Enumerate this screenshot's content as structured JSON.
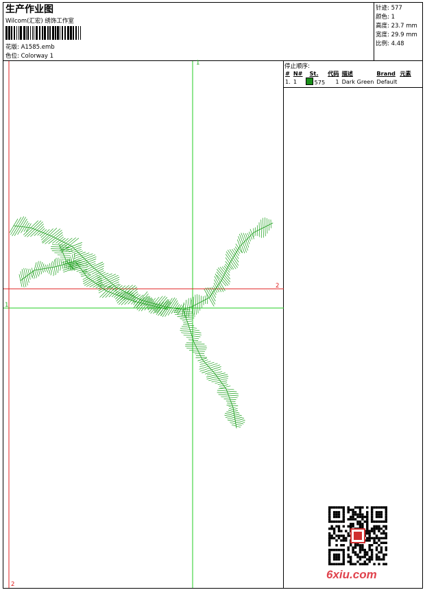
{
  "header": {
    "title": "生产作业图",
    "subtitle": "Wilcom(汇宏) 绣饰工作室",
    "design_label": "花版:",
    "design_value": "A1585.emb",
    "colorway_label": "色位:",
    "colorway_value": "Colorway 1"
  },
  "stats": {
    "stitches_label": "针迹:",
    "stitches": "577",
    "colors_label": "颜色:",
    "colors": "1",
    "height_label": "高度:",
    "height": "23.7 mm",
    "width_label": "宽度:",
    "width": "29.9 mm",
    "scale_label": "比例:",
    "scale": "4.48"
  },
  "stop_sequence": {
    "title": "停止顺序:",
    "columns": [
      "#",
      "N#",
      "St.",
      "代码",
      "描述",
      "Brand",
      "元素"
    ],
    "rows": [
      {
        "num": "1.",
        "n": "1",
        "color": "#1a8f1a",
        "stitches": "575",
        "code": "1",
        "description": "Dark Green",
        "brand": "Default",
        "element": ""
      }
    ]
  },
  "axes": {
    "green_v_top": "1",
    "green_h_left": "1",
    "red_h_right": "2",
    "red_v_bottom": "2"
  },
  "colors": {
    "thread": "#1a9e1a",
    "guide_green": "#22cc22",
    "guide_red": "#e02020",
    "watermark": "#e0434d"
  },
  "watermark": {
    "text": "6xiu.com"
  }
}
